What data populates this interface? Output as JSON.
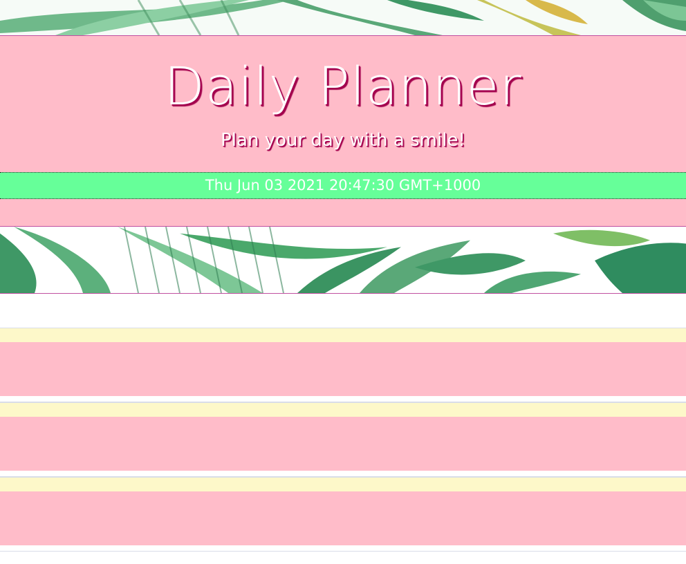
{
  "header": {
    "title": "Daily Planner",
    "subtitle": "Plan your day with a smile!"
  },
  "current_date": "Thu Jun 03 2021 20:47:30 GMT+1000",
  "time_blocks": [
    {
      "hour": "",
      "entry": ""
    },
    {
      "hour": "",
      "entry": ""
    },
    {
      "hour": "",
      "entry": ""
    }
  ],
  "colors": {
    "header_bg": "#ffbcc9",
    "title_shadow": "#a3004d",
    "date_bar_bg": "#66ff99",
    "hour_strip": "#fdf8c9",
    "leaf_green": "#4aa86b"
  }
}
